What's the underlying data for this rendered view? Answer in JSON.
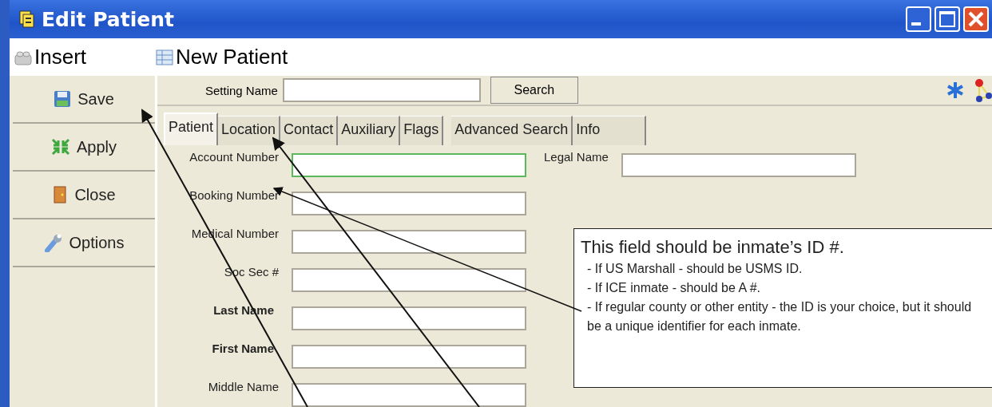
{
  "window": {
    "title": "Edit Patient"
  },
  "header": {
    "left": "Insert",
    "right": "New Patient"
  },
  "actions": [
    {
      "label": "Save",
      "kind": "save"
    },
    {
      "label": "Apply",
      "kind": "apply"
    },
    {
      "label": "Close",
      "kind": "close"
    },
    {
      "label": "Options",
      "kind": "options"
    }
  ],
  "search": {
    "label": "Setting Name",
    "button": "Search"
  },
  "tabs": [
    {
      "label": "Patient",
      "selected": true
    },
    {
      "label": "Location",
      "selected": false
    },
    {
      "label": "Contact",
      "selected": false
    },
    {
      "label": "Auxiliary",
      "selected": false
    },
    {
      "label": "Flags",
      "selected": false
    },
    {
      "label": "Advanced Search",
      "selected": false
    },
    {
      "label": "Info",
      "selected": false
    }
  ],
  "fields": [
    {
      "label": "Account Number",
      "bold": false,
      "focused": true
    },
    {
      "label": "Booking Number",
      "bold": false,
      "focused": false
    },
    {
      "label": "Medical Number",
      "bold": false,
      "focused": false
    },
    {
      "label": "Soc Sec #",
      "bold": false,
      "focused": false
    },
    {
      "label": "Last Name",
      "bold": true,
      "focused": false
    },
    {
      "label": "First Name",
      "bold": true,
      "focused": false
    },
    {
      "label": "Middle Name",
      "bold": false,
      "focused": false
    }
  ],
  "side_field": {
    "label": "Legal Name"
  },
  "callout": {
    "title": "This field should be inmate’s ID #.",
    "lines": [
      "- If US Marshall - should be USMS ID.",
      "- If ICE inmate - should be A #.",
      "- If regular county or other entity - the ID is your choice, but it should be a unique identifier for each inmate."
    ]
  }
}
